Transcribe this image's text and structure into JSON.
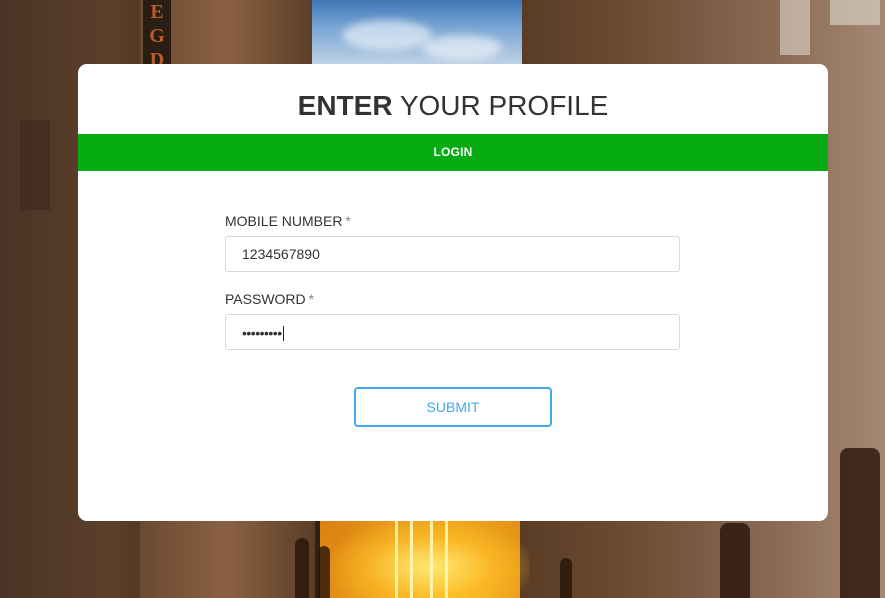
{
  "form": {
    "title_bold": "ENTER",
    "title_rest": "YOUR PROFILE",
    "tab_login": "LOGIN",
    "mobile_label": "MOBILE NUMBER",
    "mobile_value": "1234567890",
    "password_label": "PASSWORD",
    "password_value": "•••••••••",
    "required_mark": "*",
    "submit_label": "SUBMIT"
  },
  "colors": {
    "tab_bar": "#07ac12",
    "submit_accent": "#42a9e6",
    "card": "#ffffff"
  },
  "background": {
    "sign_letters": [
      "E",
      "G",
      "D"
    ]
  }
}
